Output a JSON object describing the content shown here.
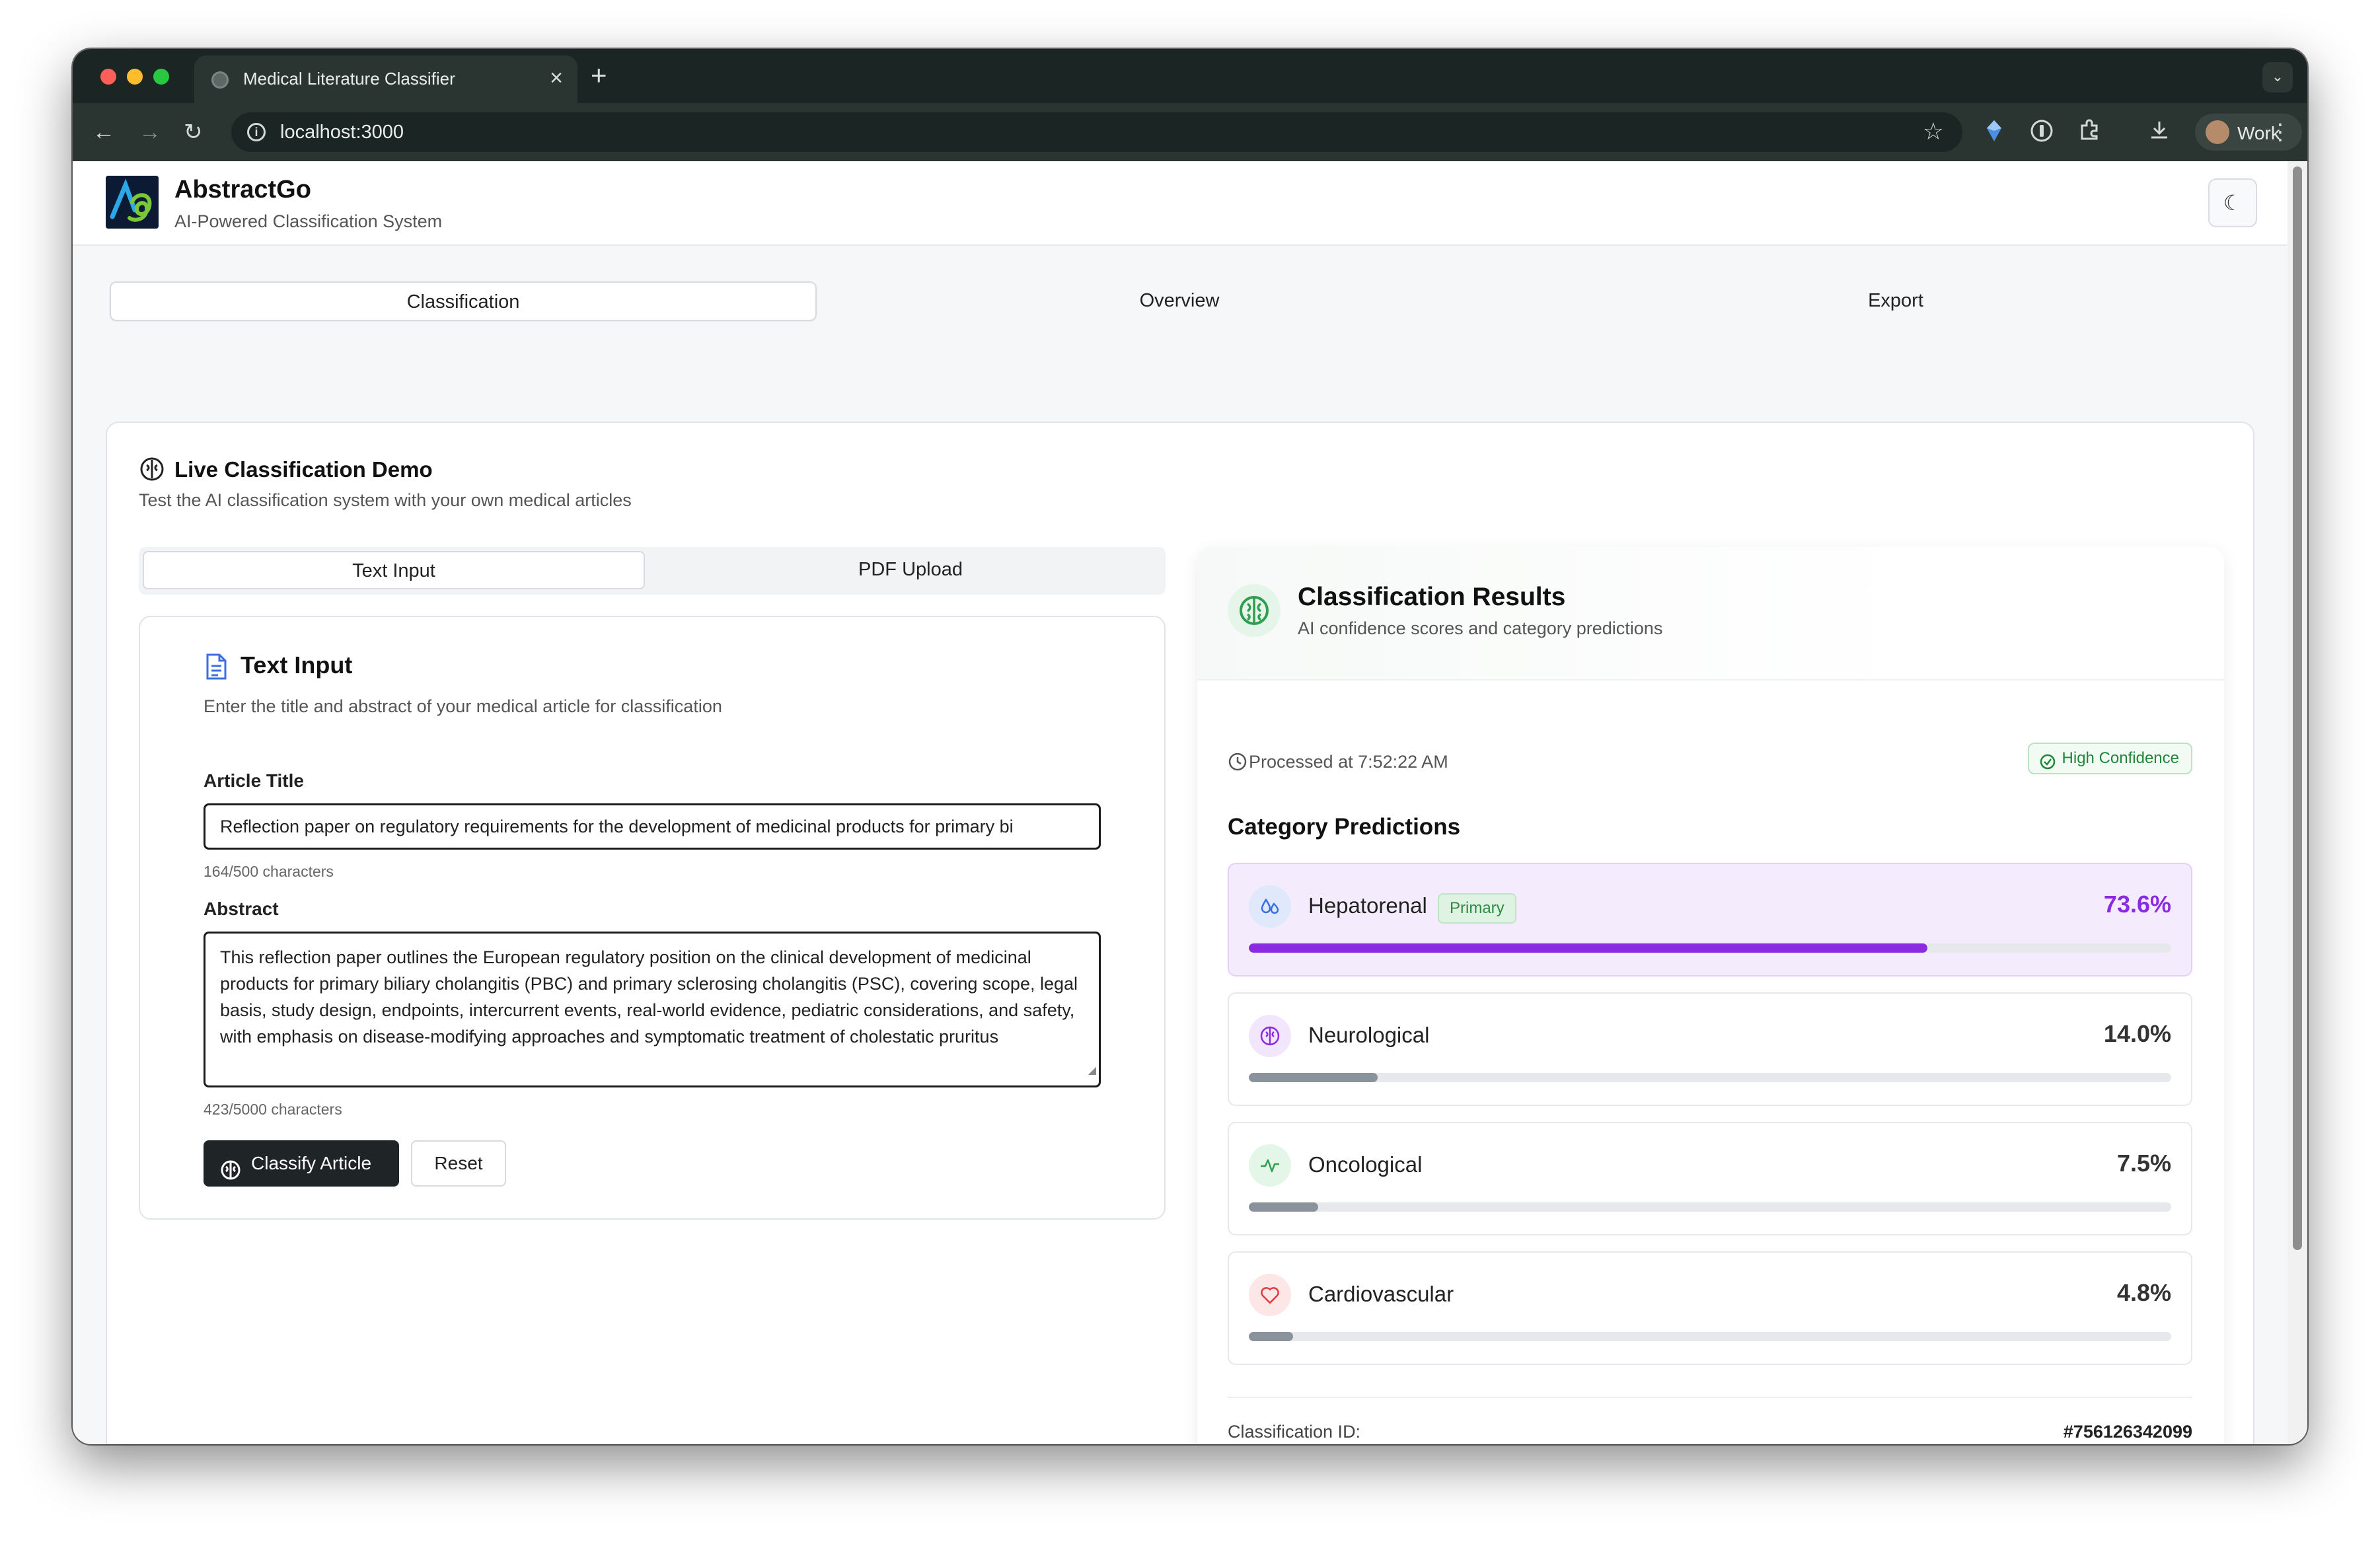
{
  "browser": {
    "tab_title": "Medical Literature Classifier",
    "url": "localhost:3000",
    "profile_label": "Work"
  },
  "app": {
    "brand_title": "AbstractGo",
    "brand_subtitle": "AI-Powered Classification System",
    "main_tabs": [
      {
        "label": "Classification",
        "active": true
      },
      {
        "label": "Overview",
        "active": false
      },
      {
        "label": "Export",
        "active": false
      }
    ]
  },
  "demo": {
    "title": "Live Classification Demo",
    "subtitle": "Test the AI classification system with your own medical articles",
    "input_tabs": [
      {
        "label": "Text Input",
        "active": true
      },
      {
        "label": "PDF Upload",
        "active": false
      }
    ]
  },
  "text_input": {
    "title": "Text Input",
    "subtitle": "Enter the title and abstract of your medical article for classification",
    "article_title_label": "Article Title",
    "article_title_value": "Reflection paper on regulatory requirements for the development of medicinal products for primary bi",
    "article_title_count": "164/500 characters",
    "abstract_label": "Abstract",
    "abstract_value": "This reflection paper outlines the European regulatory position on the clinical development of medicinal products for primary biliary cholangitis (PBC) and primary sclerosing cholangitis (PSC), covering scope, legal basis, study design, endpoints, intercurrent events, real-world evidence, pediatric considerations, and safety, with emphasis on disease-modifying approaches and symptomatic treatment of cholestatic pruritus",
    "abstract_count": "423/5000 characters",
    "classify_label": "Classify Article",
    "reset_label": "Reset"
  },
  "results": {
    "title": "Classification Results",
    "subtitle": "AI confidence scores and category predictions",
    "processed": "Processed at 7:52:22 AM",
    "confidence_badge": "High Confidence",
    "category_heading": "Category Predictions",
    "predictions": [
      {
        "name": "Hepatorenal",
        "badge": "Primary",
        "percent_label": "73.6%",
        "value": 73.6,
        "icon": "droplets-icon",
        "color": "#8a2be2"
      },
      {
        "name": "Neurological",
        "badge": "",
        "percent_label": "14.0%",
        "value": 14.0,
        "icon": "brain-icon",
        "color": "#8a939c"
      },
      {
        "name": "Oncological",
        "badge": "",
        "percent_label": "7.5%",
        "value": 7.5,
        "icon": "activity-icon",
        "color": "#8a939c"
      },
      {
        "name": "Cardiovascular",
        "badge": "",
        "percent_label": "4.8%",
        "value": 4.8,
        "icon": "heart-icon",
        "color": "#8a939c"
      }
    ],
    "class_id_label": "Classification ID:",
    "class_id_value": "#756126342099"
  },
  "colors": {
    "accent_purple": "#8a2be2",
    "success_green": "#22863a",
    "chrome_dark": "#1b2523"
  }
}
